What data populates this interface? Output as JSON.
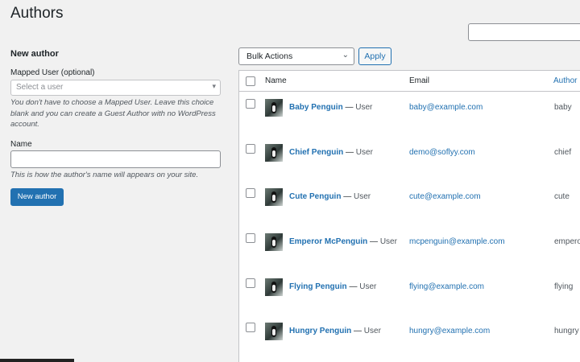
{
  "page": {
    "title": "Authors"
  },
  "search": {
    "placeholder": ""
  },
  "new_author_form": {
    "heading": "New author",
    "mapped_user_label": "Mapped User (optional)",
    "mapped_user_placeholder": "Select a user",
    "mapped_user_help": "You don't have to choose a Mapped User. Leave this choice blank and you can create a Guest Author with no WordPress account.",
    "name_label": "Name",
    "name_value": "",
    "name_help": "This is how the author's name will appears on your site.",
    "submit_label": "New author"
  },
  "bulk": {
    "selected": "Bulk Actions",
    "apply_label": "Apply"
  },
  "table": {
    "columns": {
      "name": "Name",
      "email": "Email",
      "author": "Author"
    },
    "rows": [
      {
        "name": "Baby Penguin",
        "role": "User",
        "email": "baby@example.com",
        "slug": "baby"
      },
      {
        "name": "Chief Penguin",
        "role": "User",
        "email": "demo@soflyy.com",
        "slug": "chief"
      },
      {
        "name": "Cute Penguin",
        "role": "User",
        "email": "cute@example.com",
        "slug": "cute"
      },
      {
        "name": "Emperor McPenguin",
        "role": "User",
        "email": "mcpenguin@example.com",
        "slug": "emperor"
      },
      {
        "name": "Flying Penguin",
        "role": "User",
        "email": "flying@example.com",
        "slug": "flying"
      },
      {
        "name": "Hungry Penguin",
        "role": "User",
        "email": "hungry@example.com",
        "slug": "hungry"
      }
    ]
  },
  "colors": {
    "accent": "#2271b1",
    "background": "#f1f1f1",
    "text": "#1d2327"
  }
}
